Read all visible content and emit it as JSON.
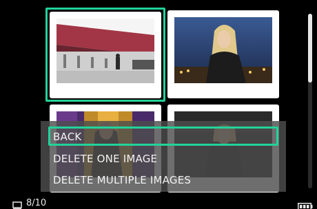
{
  "menu": {
    "items": [
      {
        "label": "BACK",
        "selected": true
      },
      {
        "label": "DELETE ONE IMAGE",
        "selected": false
      },
      {
        "label": "DELETE MULTIPLE IMAGES",
        "selected": false
      }
    ]
  },
  "status": {
    "counter": "8/10",
    "view_icon": "single-frame-icon",
    "battery_icon": "battery-full-icon"
  },
  "thumbnails": [
    {
      "name": "thumb-1",
      "selected": true
    },
    {
      "name": "thumb-2",
      "selected": false
    },
    {
      "name": "thumb-3",
      "selected": false
    },
    {
      "name": "thumb-4",
      "selected": false
    }
  ],
  "colors": {
    "accent": "#22d39a",
    "background": "#000000",
    "menu_bg": "#4e4e4e",
    "text": "#f2f2f2"
  }
}
